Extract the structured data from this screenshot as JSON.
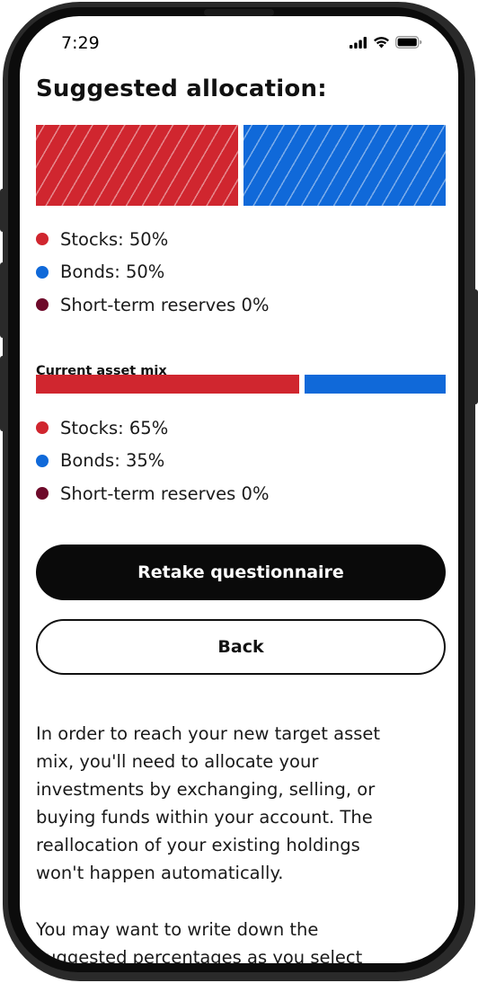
{
  "status_bar": {
    "time": "7:29"
  },
  "title": "Suggested allocation:",
  "suggested": {
    "segments": [
      {
        "name": "Stocks",
        "percent": 50,
        "color": "#d0262f"
      },
      {
        "name": "Bonds",
        "percent": 50,
        "color": "#1069d9"
      }
    ],
    "legend": [
      {
        "label": "Stocks: 50%",
        "color": "#d0262f"
      },
      {
        "label": "Bonds: 50%",
        "color": "#1069d9"
      },
      {
        "label": "Short-term reserves 0%",
        "color": "#6e0a2a"
      }
    ]
  },
  "current": {
    "heading": "Current asset mix",
    "segments": [
      {
        "name": "Stocks",
        "percent": 65,
        "color": "#d0262f"
      },
      {
        "name": "Bonds",
        "percent": 35,
        "color": "#1069d9"
      }
    ],
    "legend": [
      {
        "label": "Stocks: 65%",
        "color": "#d0262f"
      },
      {
        "label": "Bonds: 35%",
        "color": "#1069d9"
      },
      {
        "label": "Short-term reserves 0%",
        "color": "#6e0a2a"
      }
    ]
  },
  "buttons": {
    "retake": "Retake questionnaire",
    "back": "Back"
  },
  "body": {
    "paragraph1_lines": [
      "In order to reach your new target asset",
      "mix, you'll need to allocate your",
      "investments by exchanging, selling, or",
      "buying funds within your account. The",
      "reallocation of your existing holdings",
      "won't happen automatically."
    ],
    "paragraph2_lines": [
      "You may want to write down the",
      "suggested percentages as you select"
    ]
  }
}
